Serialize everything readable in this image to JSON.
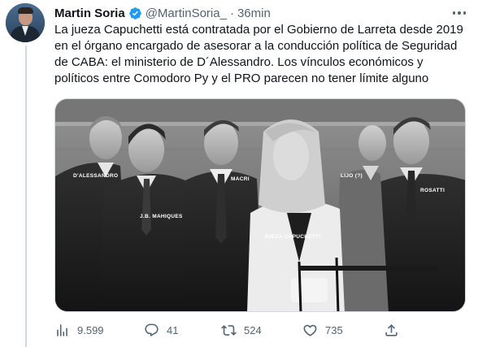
{
  "author": {
    "name": "Martin Soria",
    "handle": "@MartinSoria_",
    "time": "36min"
  },
  "tweet_text": "La jueza Capuchetti está contratada por el Gobierno de Larreta desde 2019 en el órgano encargado de asesorar a la conducción política de Seguridad de CABA: el ministerio de D´Alessandro. Los vínculos económicos y políticos entre Comodoro Py y el PRO parecen no tener límite alguno",
  "image_labels": {
    "dalessandro": "D'ALESSANDRO",
    "mahiques": "J.B. MAHIQUES",
    "macri": "MACRI",
    "capuchetti": "JUEZA CAPUCHETTI",
    "lijo": "LIJO (?)",
    "rosatti": "ROSATTI"
  },
  "actions": {
    "views": "9.599",
    "replies": "41",
    "retweets": "524",
    "likes": "735"
  },
  "icons": {
    "verified": "verified-badge-icon",
    "more": "more-icon",
    "views": "views-icon",
    "reply": "reply-icon",
    "retweet": "retweet-icon",
    "like": "heart-icon",
    "share": "share-icon"
  },
  "colors": {
    "verified": "#1d9bf0",
    "secondary_text": "#536471"
  }
}
